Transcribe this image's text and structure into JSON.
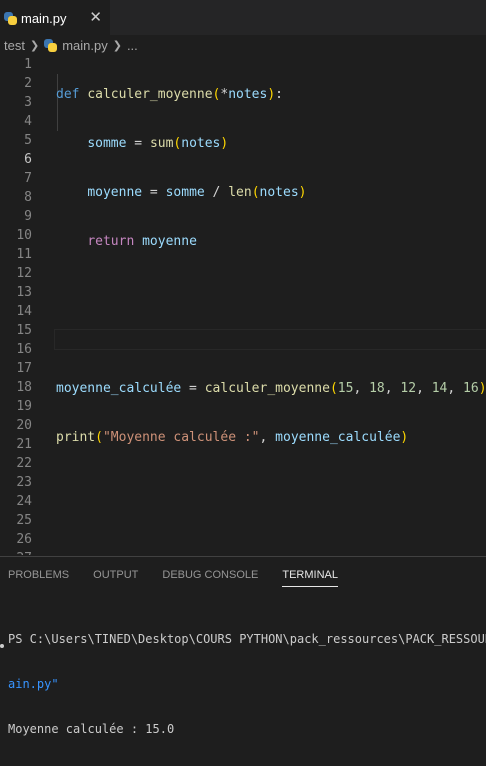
{
  "tab": {
    "label": "main.py",
    "close": "✕"
  },
  "breadcrumb": {
    "folder": "test",
    "file": "main.py",
    "more": "..."
  },
  "line_numbers": [
    "1",
    "2",
    "3",
    "4",
    "5",
    "6",
    "7",
    "8",
    "9",
    "10",
    "11",
    "12",
    "13",
    "14",
    "15",
    "16",
    "17",
    "18",
    "19",
    "20",
    "21",
    "22",
    "23",
    "24",
    "25",
    "26",
    "27"
  ],
  "code": {
    "l1": {
      "kw": "def",
      "fn": "calculer_moyenne",
      "p1": "(",
      "op": "*",
      "param": "notes",
      "p2": ")",
      "colon": ":"
    },
    "l2": {
      "var": "somme",
      "eq": " = ",
      "fn": "sum",
      "p1": "(",
      "arg": "notes",
      "p2": ")"
    },
    "l3": {
      "var": "moyenne",
      "eq": " = ",
      "a": "somme",
      "div": " / ",
      "fn": "len",
      "p1": "(",
      "arg": "notes",
      "p2": ")"
    },
    "l4": {
      "kw": "return",
      "var": "moyenne"
    },
    "l7": {
      "var": "moyenne_calculée",
      "eq": " = ",
      "fn": "calculer_moyenne",
      "p1": "(",
      "n1": "15",
      "n2": "18",
      "n3": "12",
      "n4": "14",
      "n5": "16",
      "p2": ")",
      "comma": ", "
    },
    "l8": {
      "fn": "print",
      "p1": "(",
      "str": "\"Moyenne calculée :\"",
      "comma": ", ",
      "arg": "moyenne_calculée",
      "p2": ")"
    }
  },
  "panel": {
    "tabs": [
      "PROBLEMS",
      "OUTPUT",
      "DEBUG CONSOLE",
      "TERMINAL"
    ],
    "active_tab": "TERMINAL",
    "terminal": {
      "line1": "PS C:\\Users\\TINED\\Desktop\\COURS PYTHON\\pack_ressources\\PACK_RESSOURCES",
      "line2": "ain.py\"",
      "line3": "Moyenne calculée : 15.0"
    }
  }
}
